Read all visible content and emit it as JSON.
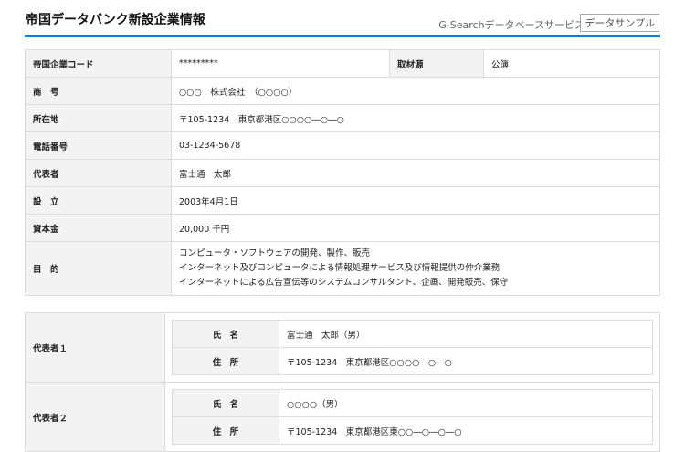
{
  "header": {
    "title": "帝国データバンク新設企業情報",
    "brand": "G-Searchデータベースサービス",
    "sample": "データサンプル"
  },
  "company": {
    "code_label": "帝国企業コード",
    "code": "*********",
    "source_label": "取材源",
    "source": "公簿",
    "name_label": "商　号",
    "name": "○○○　株式会社　（○○○○）",
    "address_label": "所在地",
    "address": "〒105-1234　東京都港区○○○○―○―○",
    "phone_label": "電話番号",
    "phone": "03-1234-5678",
    "rep_label": "代表者",
    "rep": "富士通　太郎",
    "est_label": "設　立",
    "est": "2003年4月1日",
    "capital_label": "資本金",
    "capital": "20,000 千円",
    "purpose_label": "目　的",
    "purpose": [
      "コンピュータ・ソフトウェアの開発、製作、販売",
      "インターネット及びコンピュータによる情報処理サービス及び情報提供の仲介業務",
      "インターネットによる広告宣伝等のシステムコンサルタント、企画、開発販売、保守"
    ]
  },
  "representatives": [
    {
      "label": "代表者１",
      "name_label": "氏　名",
      "name": "富士通　太郎（男）",
      "addr_label": "住　所",
      "addr": "〒105-1234　東京都港区○○○○―○―○"
    },
    {
      "label": "代表者２",
      "name_label": "氏　名",
      "name": "○○○○（男）",
      "addr_label": "住　所",
      "addr": "〒105-1234　東京都港区東○○―○―○―○"
    }
  ]
}
